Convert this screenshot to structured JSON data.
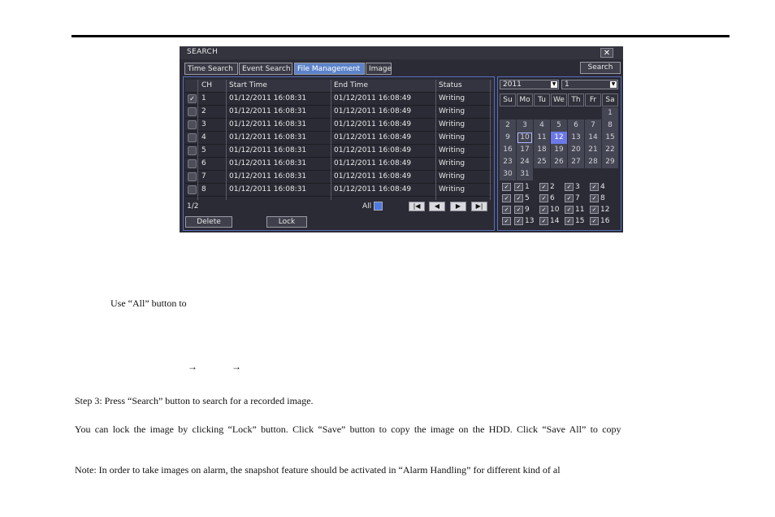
{
  "dialog": {
    "title": "SEARCH",
    "close": "✕",
    "tabs": [
      "Time Search",
      "Event Search",
      "File Management",
      "Image"
    ],
    "active_tab": "File Management",
    "search_button": "Search"
  },
  "table": {
    "headers": [
      "CH",
      "Start Time",
      "End Time",
      "Status"
    ],
    "rows": [
      {
        "checked": true,
        "ch": "1",
        "start": "01/12/2011 16:08:31",
        "end": "01/12/2011 16:08:49",
        "status": "Writing"
      },
      {
        "checked": false,
        "ch": "2",
        "start": "01/12/2011 16:08:31",
        "end": "01/12/2011 16:08:49",
        "status": "Writing"
      },
      {
        "checked": false,
        "ch": "3",
        "start": "01/12/2011 16:08:31",
        "end": "01/12/2011 16:08:49",
        "status": "Writing"
      },
      {
        "checked": false,
        "ch": "4",
        "start": "01/12/2011 16:08:31",
        "end": "01/12/2011 16:08:49",
        "status": "Writing"
      },
      {
        "checked": false,
        "ch": "5",
        "start": "01/12/2011 16:08:31",
        "end": "01/12/2011 16:08:49",
        "status": "Writing"
      },
      {
        "checked": false,
        "ch": "6",
        "start": "01/12/2011 16:08:31",
        "end": "01/12/2011 16:08:49",
        "status": "Writing"
      },
      {
        "checked": false,
        "ch": "7",
        "start": "01/12/2011 16:08:31",
        "end": "01/12/2011 16:08:49",
        "status": "Writing"
      },
      {
        "checked": false,
        "ch": "8",
        "start": "01/12/2011 16:08:31",
        "end": "01/12/2011 16:08:49",
        "status": "Writing"
      }
    ]
  },
  "pager": {
    "page": "1/2",
    "all_label": "All",
    "nav": [
      "first-page-icon",
      "prev-page-icon",
      "next-page-icon",
      "last-page-icon"
    ]
  },
  "actions": {
    "delete": "Delete",
    "lock": "Lock"
  },
  "calendar": {
    "year": "2011",
    "month": "1",
    "weekdays": [
      "Su",
      "Mo",
      "Tu",
      "We",
      "Th",
      "Fr",
      "Sa"
    ],
    "weeks": [
      [
        "",
        "",
        "",
        "",
        "",
        "",
        "1"
      ],
      [
        "2",
        "3",
        "4",
        "5",
        "6",
        "7",
        "8"
      ],
      [
        "9",
        "10",
        "11",
        "12",
        "13",
        "14",
        "15"
      ],
      [
        "16",
        "17",
        "18",
        "19",
        "20",
        "21",
        "22"
      ],
      [
        "23",
        "24",
        "25",
        "26",
        "27",
        "28",
        "29"
      ],
      [
        "30",
        "31",
        "",
        "",
        "",
        "",
        ""
      ]
    ],
    "today": "10",
    "selected": "12"
  },
  "channels": {
    "all_checked": true,
    "items": [
      "1",
      "2",
      "3",
      "4",
      "5",
      "6",
      "7",
      "8",
      "9",
      "10",
      "11",
      "12",
      "13",
      "14",
      "15",
      "16"
    ]
  },
  "document": {
    "line1": "Use “All” button to",
    "arrows": [
      "→",
      "→"
    ],
    "step3": "Step 3: Press “Search” button to search for a recorded image.",
    "lock_text": "You can lock the image by clicking “Lock” button. Click “Save” button to copy the image on the HDD. Click “Save All” to copy",
    "note": "Note: In order to take images on alarm, the snapshot feature should be activated in “Alarm Handling” for different kind of al"
  },
  "colors": {
    "dialog_bg": "#2a2b35",
    "active_tab": "#5c83c9",
    "panel_border": "#5a6fbe",
    "selected_day": "#6b78e6"
  }
}
